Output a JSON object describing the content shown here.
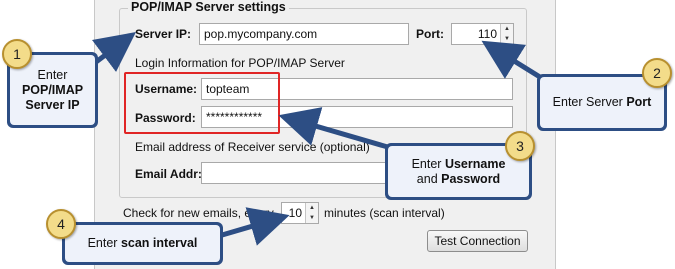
{
  "group": {
    "title": "POP/IMAP Server settings",
    "server_ip_label": "Server IP:",
    "server_ip_value": "pop.mycompany.com",
    "port_label": "Port:",
    "port_value": "110",
    "login_info_label": "Login Information for POP/IMAP Server",
    "username_label": "Username:",
    "username_value": "topteam",
    "password_label": "Password:",
    "password_value": "************",
    "email_info_label": "Email address of Receiver service (optional)",
    "email_addr_label": "Email Addr:",
    "email_addr_value": ""
  },
  "scan": {
    "prefix": "Check for new emails, every",
    "value": "10",
    "suffix": "minutes (scan interval)"
  },
  "test_button": "Test Connection",
  "callouts": {
    "c1": {
      "number": "1",
      "line1": "Enter",
      "line2": "POP/IMAP",
      "line3": "Server IP"
    },
    "c2": {
      "number": "2",
      "pre": "Enter Server ",
      "bold": "Port"
    },
    "c3": {
      "number": "3",
      "pre": "Enter ",
      "bold1": "Username",
      "mid": "and ",
      "bold2": "Password"
    },
    "c4": {
      "number": "4",
      "pre": "Enter ",
      "bold": "scan interval"
    }
  },
  "colors": {
    "callout_border": "#2d4e84",
    "callout_fill": "#eef2fa",
    "badge_fill": "#f3dc8a",
    "highlight": "#e02525"
  }
}
